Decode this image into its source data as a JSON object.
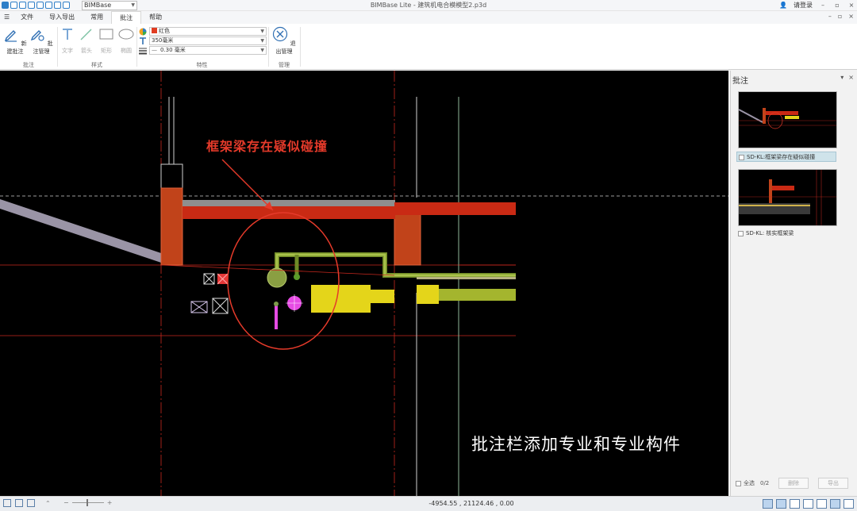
{
  "titlebar": {
    "project_select": "BIMBase",
    "window_title": "BIMBase Lite - 建筑机电合模模型2.p3d",
    "login": "请登录"
  },
  "menubar": {
    "hamburger": "☰",
    "items": [
      "文件",
      "导入导出",
      "常用",
      "批注",
      "帮助"
    ],
    "active": "批注"
  },
  "ribbon": {
    "annotation": {
      "new_label": "新建批注",
      "manage_label": "批注管理",
      "group_label": "批注"
    },
    "style": {
      "text_label": "文字",
      "arrow_label": "箭头",
      "rect_label": "矩形",
      "ellipse_label": "椭圆",
      "group_label": "样式"
    },
    "properties": {
      "color_value": "红色",
      "text_size_value": "350毫米",
      "line_width_value": "0.30 毫米",
      "group_label": "特性"
    },
    "manage": {
      "exit_label": "退出管理",
      "group_label": "管理"
    }
  },
  "canvas": {
    "annotation_text": "框架梁存在疑似碰撞",
    "caption": "批注栏添加专业和专业构件",
    "annotation_color": "#e53a2a"
  },
  "panel": {
    "title": "批注",
    "items": [
      {
        "label": "SD-KL:框架梁存在疑似碰撞",
        "selected": true
      },
      {
        "label": "SD-KL: 核实框架梁",
        "selected": false
      }
    ],
    "select_all": "全选",
    "count": "0/2",
    "delete_label": "删除",
    "export_label": "导出"
  },
  "statusbar": {
    "zoom_minus": "−",
    "zoom_plus": "+",
    "coordinates": "-4954.55 , 21124.46 , 0.00"
  }
}
